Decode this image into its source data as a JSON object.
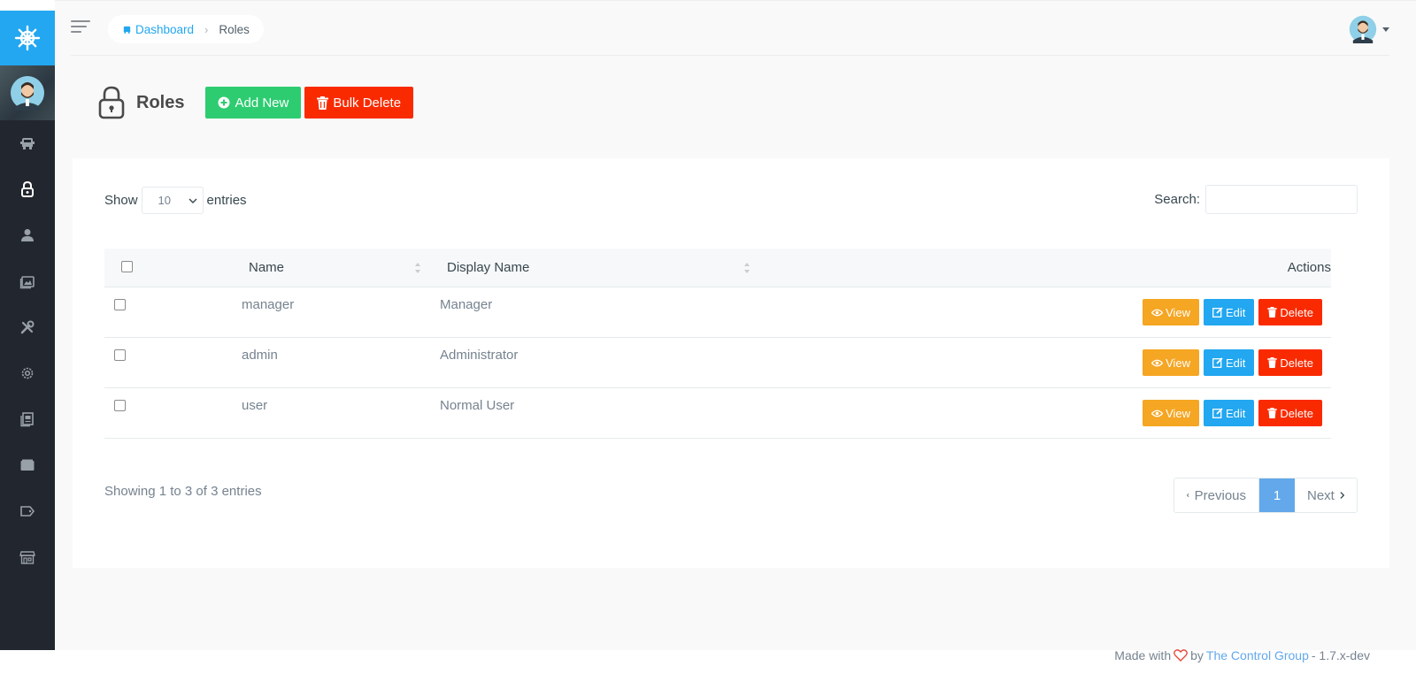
{
  "breadcrumb": {
    "home": "Dashboard",
    "current": "Roles"
  },
  "page": {
    "title": "Roles",
    "add_new": "Add New",
    "bulk_delete": "Bulk Delete"
  },
  "datatable": {
    "show_label": "Show",
    "entries_label": "entries",
    "page_length": "10",
    "search_label": "Search:",
    "search_value": "",
    "columns": {
      "name": "Name",
      "display_name": "Display Name",
      "actions": "Actions"
    },
    "rows": [
      {
        "name": "manager",
        "display_name": "Manager"
      },
      {
        "name": "admin",
        "display_name": "Administrator"
      },
      {
        "name": "user",
        "display_name": "Normal User"
      }
    ],
    "row_actions": {
      "view": "View",
      "edit": "Edit",
      "delete": "Delete"
    },
    "info": "Showing 1 to 3 of 3 entries",
    "pagination": {
      "previous": "Previous",
      "current": "1",
      "next": "Next"
    }
  },
  "footer": {
    "made_with": "Made with",
    "by": "by",
    "company": "The Control Group",
    "version": "- 1.7.x-dev"
  },
  "colors": {
    "brand": "#22a7f0",
    "sidebar": "#22262e",
    "success": "#2ecc71",
    "danger": "#fa2a00",
    "warning": "#f5a623",
    "page_active": "#62a8ea"
  },
  "sidebar_icons": [
    "helm-icon",
    "dashboard-icon",
    "lock-icon",
    "user-icon",
    "media-icon",
    "tools-icon",
    "settings-icon",
    "posts-icon",
    "categories-icon",
    "tag-icon",
    "store-icon"
  ]
}
